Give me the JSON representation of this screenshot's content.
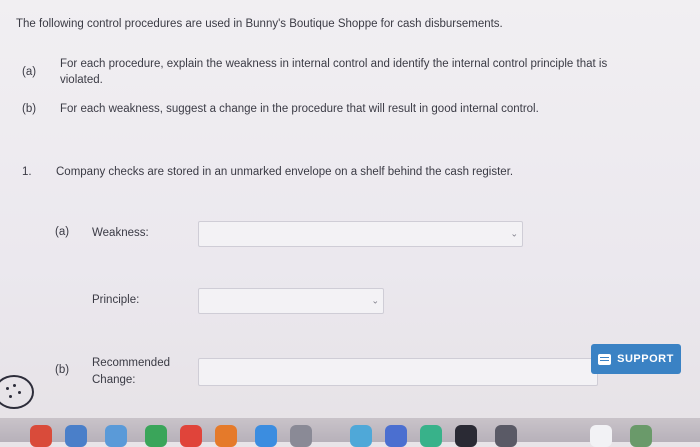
{
  "intro": "The following control procedures are used in Bunny's Boutique Shoppe for cash disbursements.",
  "parts": [
    {
      "letter": "(a)",
      "text_line1": "For each procedure, explain the weakness in internal control and identify the internal control principle that is",
      "text_line2": "violated."
    },
    {
      "letter": "(b)",
      "text": "For each weakness, suggest a change in the procedure that will result in good internal control."
    }
  ],
  "question": {
    "number": "1.",
    "text": "Company checks are stored in an unmarked envelope on a shelf behind the cash register.",
    "sub_a_letter": "(a)",
    "weakness_label": "Weakness:",
    "weakness_value": "",
    "principle_label": "Principle:",
    "principle_value": "",
    "sub_b_letter": "(b)",
    "change_label_line1": "Recommended",
    "change_label_line2": "Change:",
    "change_value": ""
  },
  "support_label": "SUPPORT",
  "colors": {
    "support": "#3a82c4",
    "select_border": "#cfcdd6"
  }
}
